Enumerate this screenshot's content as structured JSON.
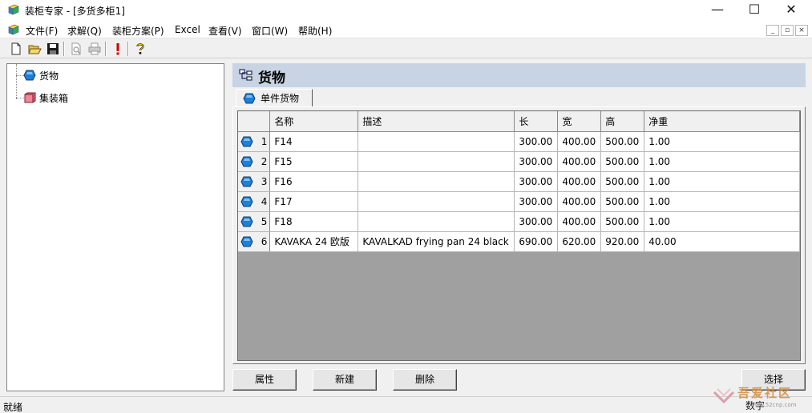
{
  "window": {
    "title": "装柜专家 - [多货多柜1]",
    "minimize": "—",
    "maximize": "☐",
    "close": "✕"
  },
  "menu": {
    "items": [
      "文件(F)",
      "求解(Q)",
      "装柜方案(P)",
      "Excel",
      "查看(V)",
      "窗口(W)",
      "帮助(H)"
    ],
    "mdi_min": "_",
    "mdi_restore": "▫",
    "mdi_close": "×"
  },
  "toolbar": {
    "buttons": [
      "new-icon",
      "open-icon",
      "save-icon",
      "print-preview-icon",
      "print-icon",
      "solve-icon",
      "help-icon"
    ]
  },
  "tree": {
    "items": [
      {
        "label": "货物",
        "icon": "cargo-icon"
      },
      {
        "label": "集装箱",
        "icon": "container-icon"
      }
    ]
  },
  "panel": {
    "title": "货物",
    "tab": "单件货物"
  },
  "table": {
    "columns": [
      "名称",
      "描述",
      "长",
      "宽",
      "高",
      "净重"
    ],
    "rows": [
      {
        "n": "1",
        "name": "F14",
        "desc": "",
        "l": "300.00",
        "w": "400.00",
        "h": "500.00",
        "wt": "1.00"
      },
      {
        "n": "2",
        "name": "F15",
        "desc": "",
        "l": "300.00",
        "w": "400.00",
        "h": "500.00",
        "wt": "1.00"
      },
      {
        "n": "3",
        "name": "F16",
        "desc": "",
        "l": "300.00",
        "w": "400.00",
        "h": "500.00",
        "wt": "1.00"
      },
      {
        "n": "4",
        "name": "F17",
        "desc": "",
        "l": "300.00",
        "w": "400.00",
        "h": "500.00",
        "wt": "1.00"
      },
      {
        "n": "5",
        "name": "F18",
        "desc": "",
        "l": "300.00",
        "w": "400.00",
        "h": "500.00",
        "wt": "1.00"
      },
      {
        "n": "6",
        "name": "KAVAKA 24 欧版",
        "desc": "KAVALKAD frying pan 24 black",
        "l": "690.00",
        "w": "620.00",
        "h": "920.00",
        "wt": "40.00"
      }
    ]
  },
  "buttons": {
    "properties": "属性",
    "new": "新建",
    "delete": "删除",
    "select": "选择"
  },
  "status": {
    "text": "就绪",
    "panel": "数字"
  },
  "watermark": {
    "text": "吾爱社区",
    "url": "www.52cnp.com"
  },
  "colors": {
    "header_band": "#c8d4e3",
    "cargo_icon": "#1e7fd6",
    "container_icon": "#e06070",
    "grid_empty": "#a0a0a0"
  }
}
